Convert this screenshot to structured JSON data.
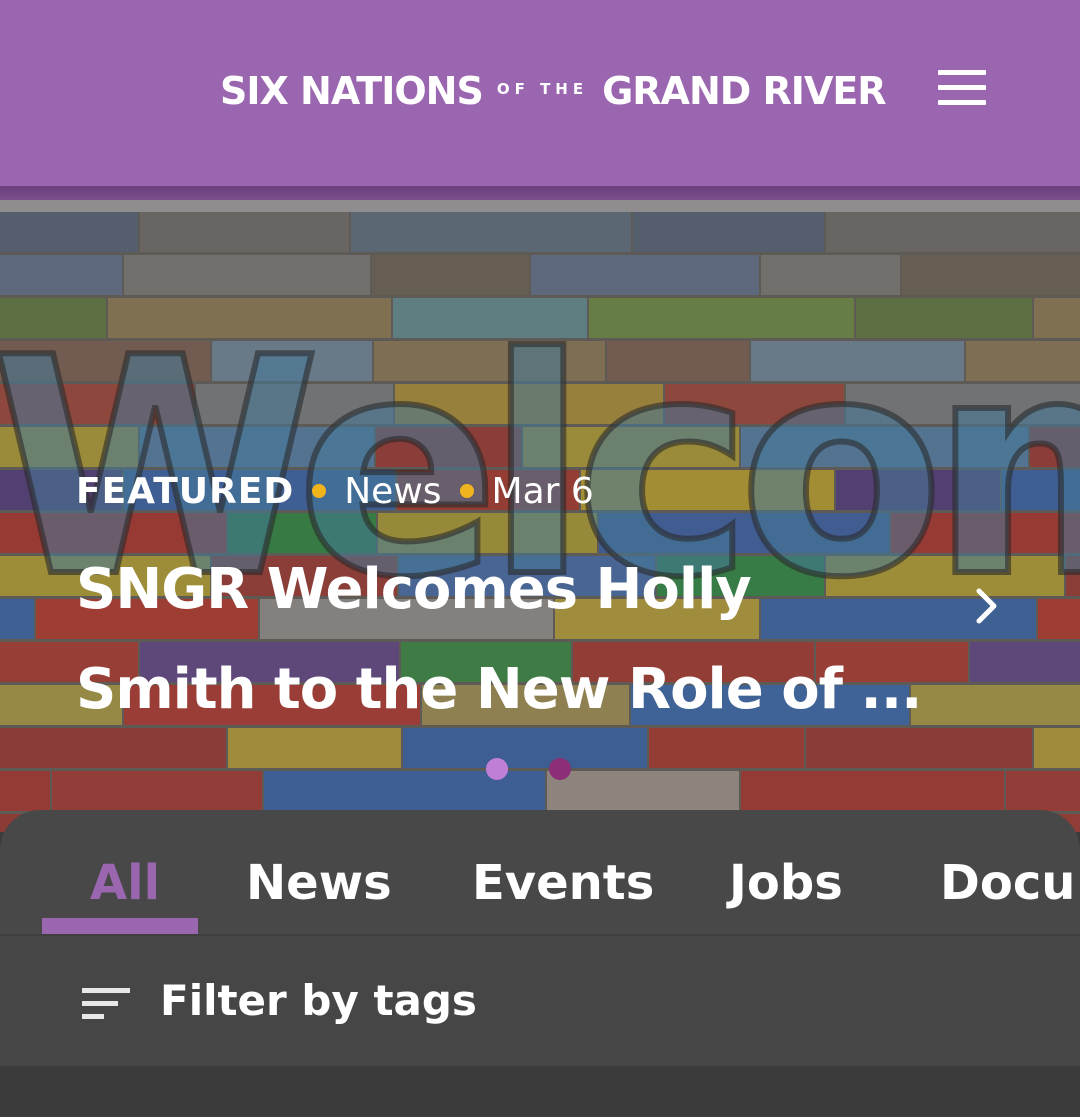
{
  "header": {
    "logo_part1": "SIX NATIONS",
    "logo_part2": "OF THE",
    "logo_part3": "GRAND RIVER",
    "menu_icon": "hamburger-menu-icon"
  },
  "hero": {
    "background_image": "welcome sign painted on rainbow wooden planks",
    "category_label": "FEATURED",
    "type_label": "News",
    "date": "Mar 6",
    "title_line1": "SNGR Welcomes Holly",
    "title_line2": "Smith to the New Role of ...",
    "next_icon": "chevron-right-icon",
    "slide_count": 2,
    "active_slide": 1
  },
  "tabs": [
    {
      "label": "All",
      "active": true
    },
    {
      "label": "News",
      "active": false
    },
    {
      "label": "Events",
      "active": false
    },
    {
      "label": "Jobs",
      "active": false
    },
    {
      "label": "Docu",
      "active": false
    }
  ],
  "filter": {
    "label": "Filter by tags",
    "icon": "filter-lines-icon"
  },
  "colors": {
    "brand_purple": "#9b66b0",
    "accent_yellow": "#f2b41c",
    "panel_gray": "#474847"
  }
}
